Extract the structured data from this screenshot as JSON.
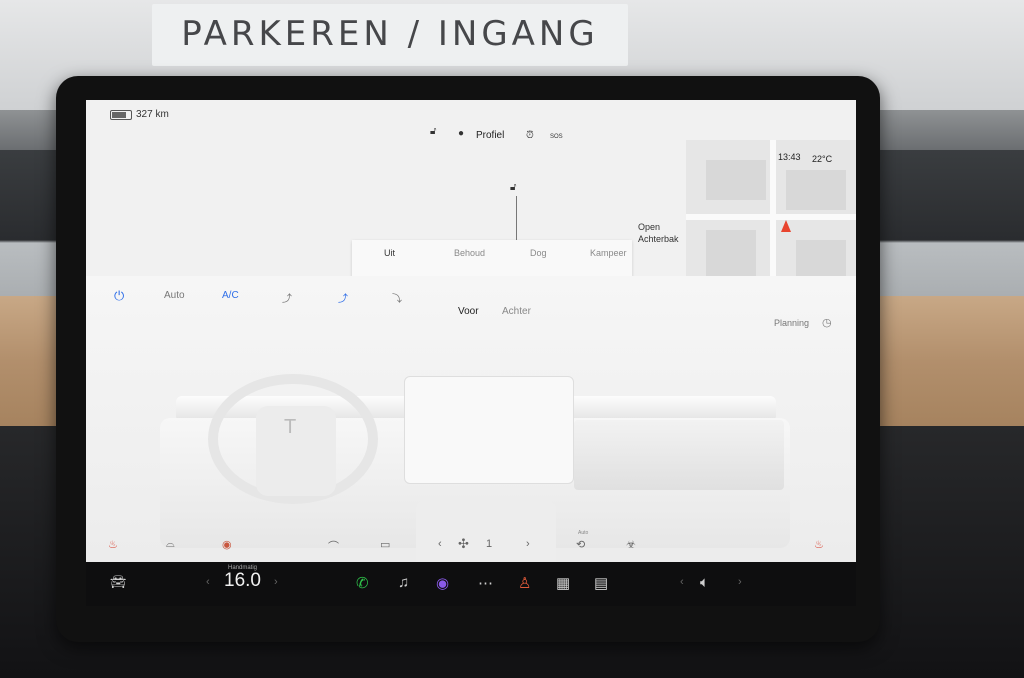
{
  "sign": {
    "text": "PARKEREN / INGANG"
  },
  "status_bar": {
    "range": "327 km",
    "battery_level": 0.7,
    "profile_label": "Profiel",
    "sos_label": "SOS",
    "time": "13:43",
    "temperature_outside": "22°C",
    "icons": [
      "lock-icon",
      "person-icon",
      "alarm-icon",
      "sos-icon"
    ]
  },
  "car": {
    "trunk": {
      "line1": "Open",
      "line2": "Achterbak"
    },
    "options": [
      "Uit",
      "Behoud",
      "Dog",
      "Kampeer"
    ]
  },
  "climate": {
    "controls": [
      "Auto",
      "A/C"
    ],
    "tabs": [
      "Voor",
      "Achter"
    ],
    "planning_label": "Planning",
    "fan_level": "1",
    "auto_label": "Auto",
    "accent_color": "#2f6ee8",
    "seat_heat_color": "#d94a3a"
  },
  "dock": {
    "temp_mode": "Handmatig",
    "temperature": "16.0",
    "icons": [
      "car-icon",
      "phone-icon",
      "music-icon",
      "camera-icon",
      "more-icon",
      "joystick-icon",
      "calendar-icon",
      "notes-icon",
      "volume-icon"
    ]
  }
}
